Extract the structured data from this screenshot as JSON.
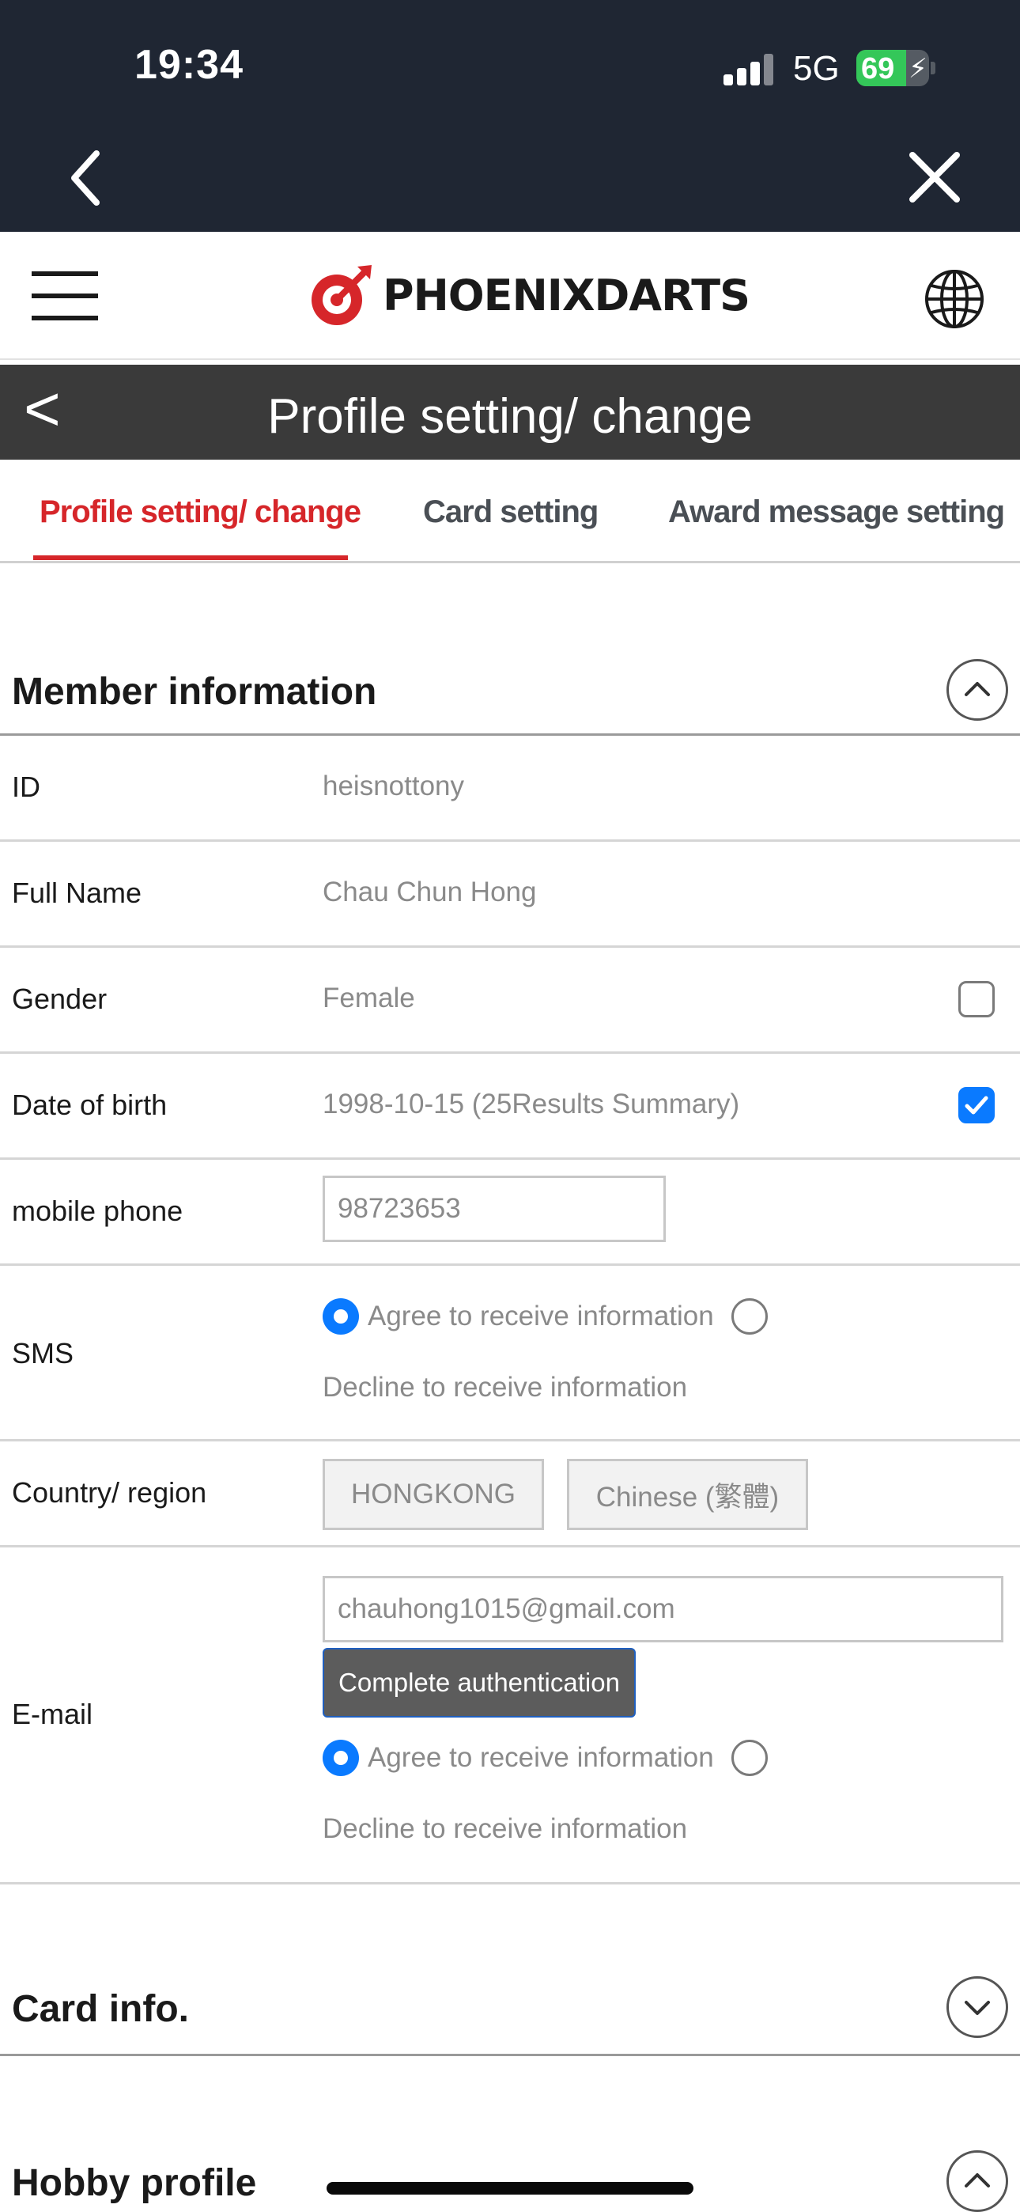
{
  "status_bar": {
    "time": "19:34",
    "network": "5G",
    "battery": "69",
    "battery_level": 0.69
  },
  "browser_nav": {
    "back_icon": "chevron-left-icon",
    "close_icon": "close-icon"
  },
  "site_header": {
    "menu_icon": "hamburger-icon",
    "logo_text": "PHOENIXDARTS",
    "language_icon": "globe-icon",
    "brand_color": "#d6262a"
  },
  "page": {
    "back_label": "<",
    "title": "Profile setting/ change"
  },
  "tabs": [
    {
      "label": "Profile setting/ change",
      "active": true
    },
    {
      "label": "Card setting",
      "active": false
    },
    {
      "label": "Award message setting",
      "active": false
    }
  ],
  "member_section": {
    "title": "Member information",
    "rows": {
      "id": {
        "label": "ID",
        "value": "heisnottony"
      },
      "full_name": {
        "label": "Full Name",
        "value": "Chau Chun Hong"
      },
      "gender": {
        "label": "Gender",
        "value": "Female",
        "checked": false
      },
      "dob": {
        "label": "Date of birth",
        "value": "1998-10-15 (25Results Summary)",
        "checked": true
      },
      "mobile": {
        "label": "mobile phone",
        "value": "98723653"
      },
      "sms": {
        "label": "SMS",
        "agree": "Agree to receive information",
        "decline": "Decline to receive information",
        "selected": "agree"
      },
      "country": {
        "label": "Country/ region",
        "country": "HONGKONG",
        "language": "Chinese (繁體)"
      },
      "email": {
        "label": "E-mail",
        "value": "chauhong1015@gmail.com",
        "auth_button": "Complete authentication",
        "agree": "Agree to receive information",
        "decline": "Decline to receive information",
        "selected": "agree"
      }
    }
  },
  "card_section": {
    "title": "Card info."
  },
  "hobby_section": {
    "title": "Hobby profile"
  }
}
